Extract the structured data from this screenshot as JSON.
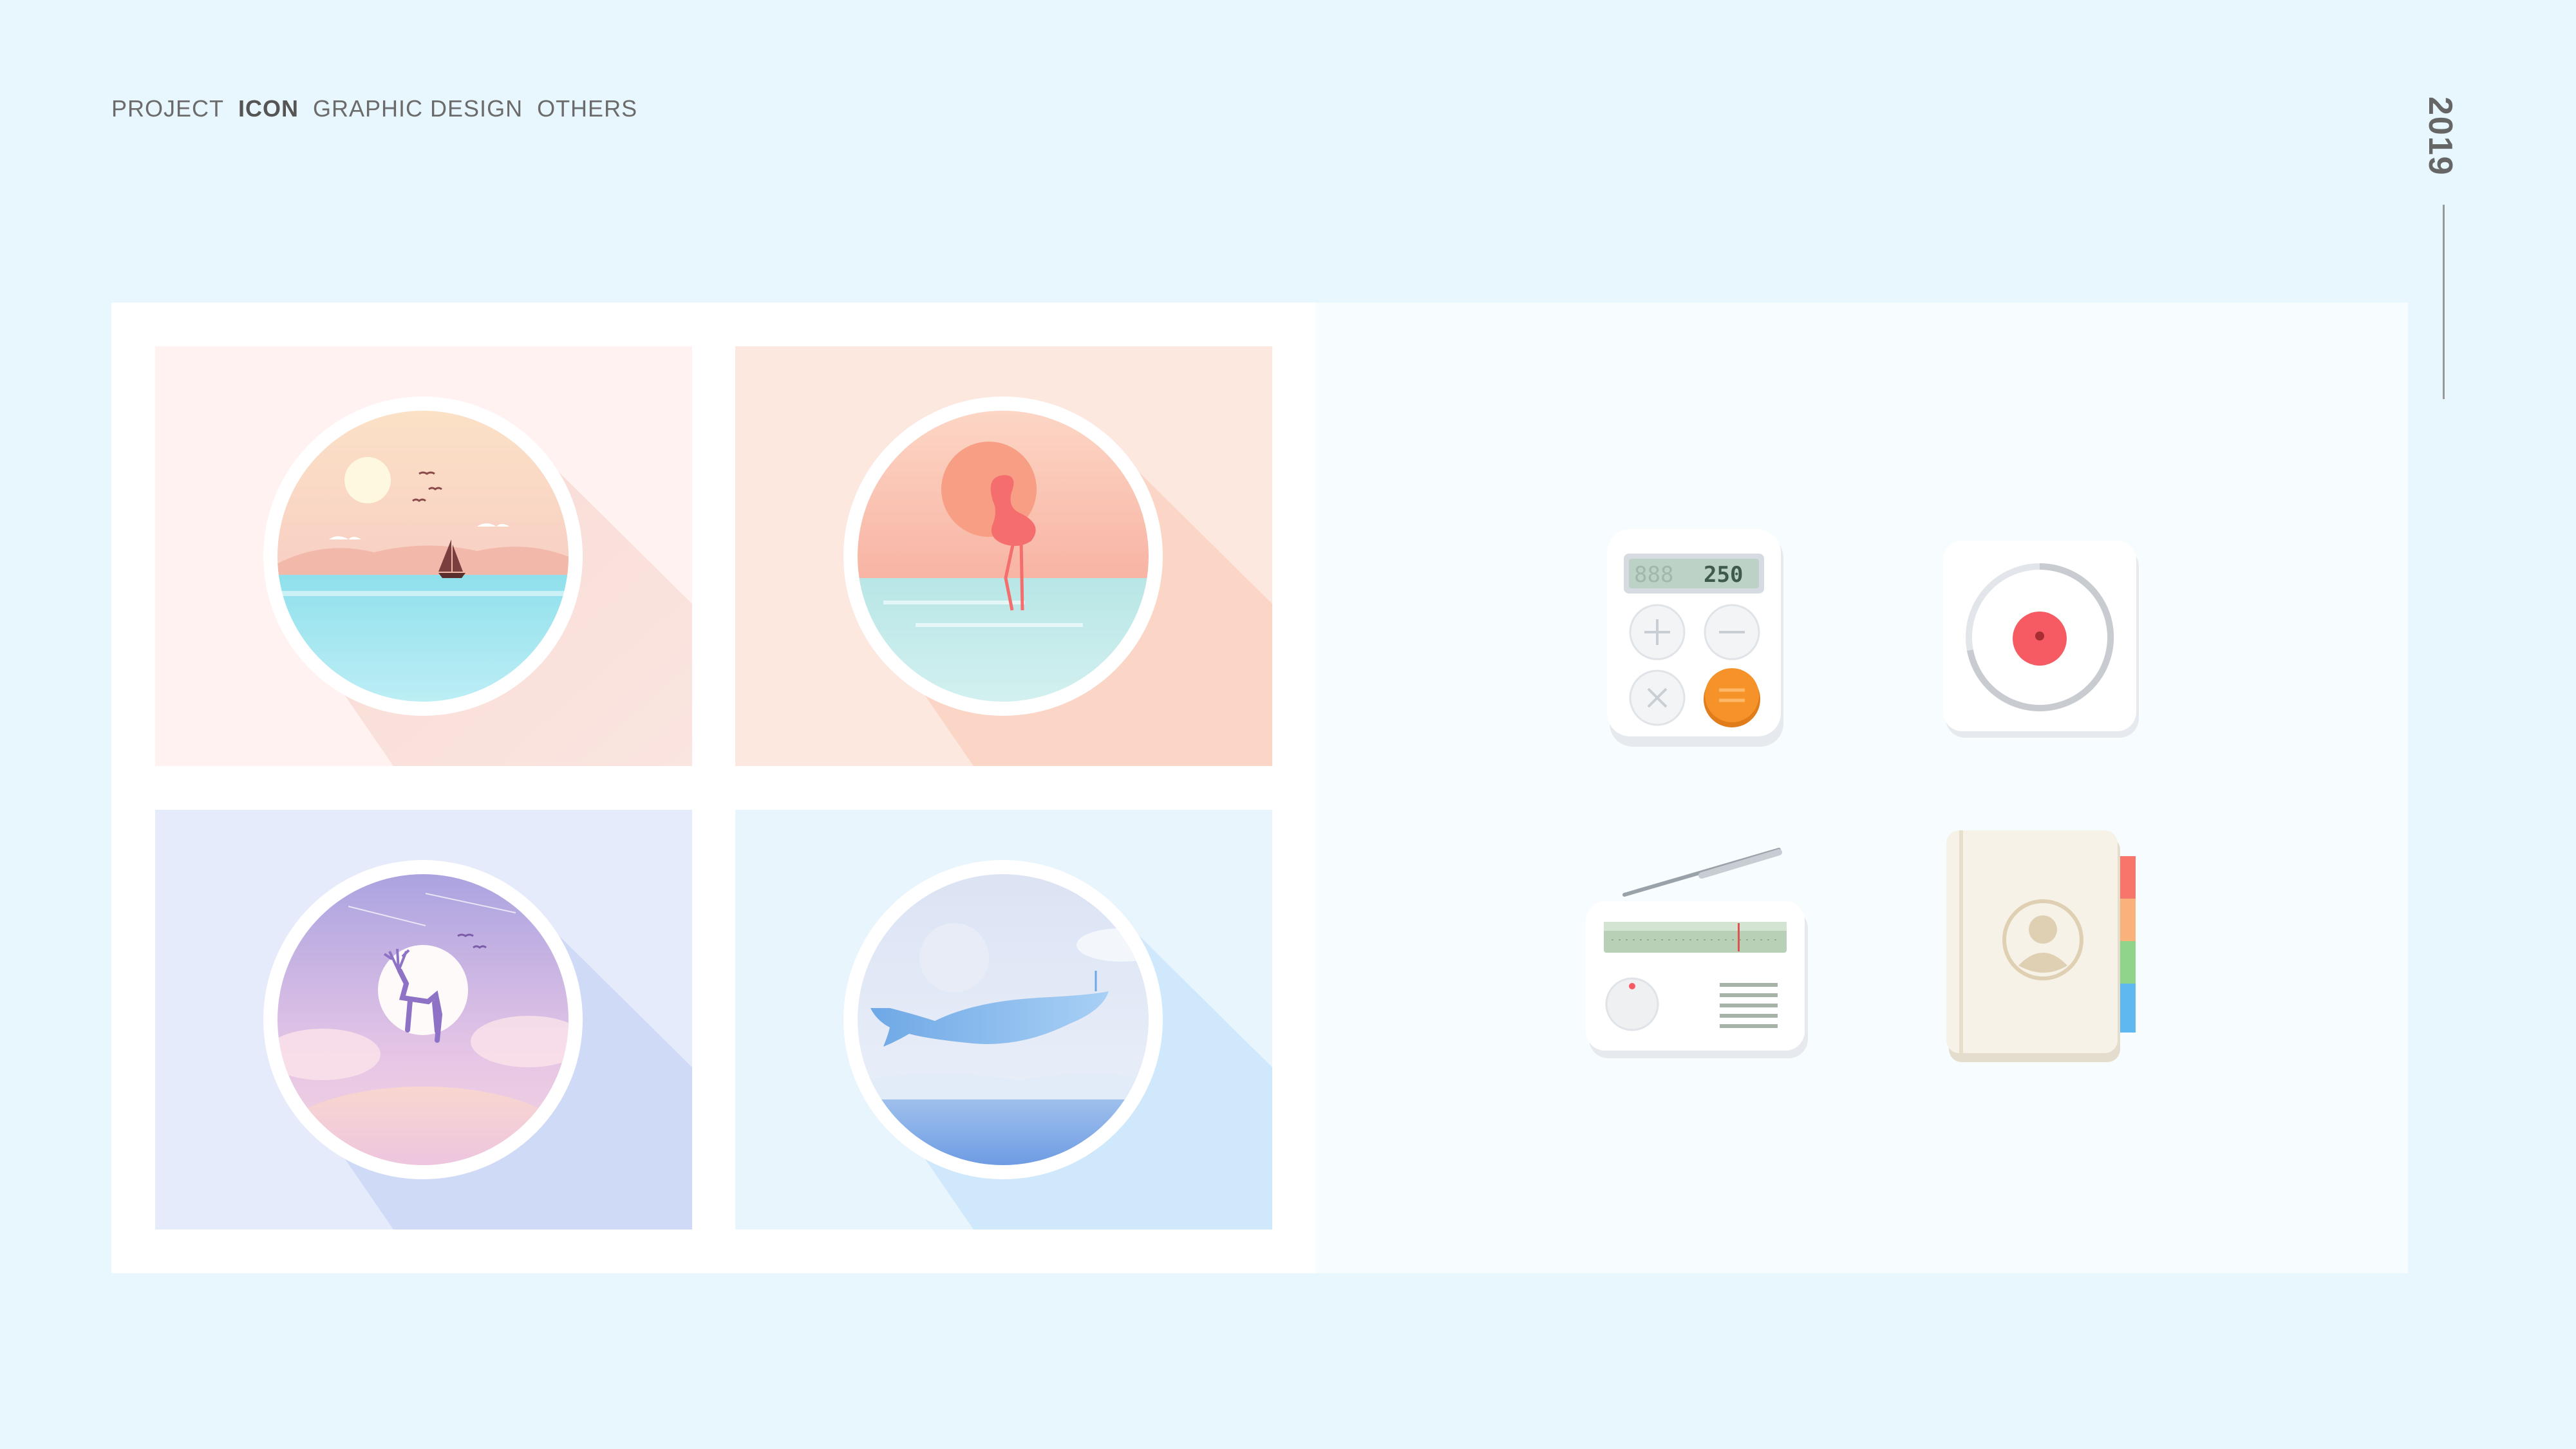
{
  "nav": {
    "items": [
      {
        "label": "PROJECT"
      },
      {
        "label": "ICON"
      },
      {
        "label": "GRAPHIC DESIGN"
      },
      {
        "label": "OTHERS"
      }
    ],
    "active": "ICON"
  },
  "year": "2019",
  "illustrations": [
    {
      "name": "sunset-sailboat-illustration",
      "bg": "#fff2f0"
    },
    {
      "name": "flamingo-illustration",
      "bg": "#fde8e0"
    },
    {
      "name": "deer-moon-illustration",
      "bg": "#e6ebfb"
    },
    {
      "name": "whale-illustration",
      "bg": "#e8f5fd"
    }
  ],
  "icons": {
    "calculator": {
      "display": "250",
      "accent": "#f5922a"
    },
    "record": {
      "accent": "#f65a62"
    },
    "radio": {},
    "contacts": {
      "tabs": [
        "#f7756b",
        "#f9b27b",
        "#8fd48a",
        "#5fb8f0"
      ]
    }
  }
}
